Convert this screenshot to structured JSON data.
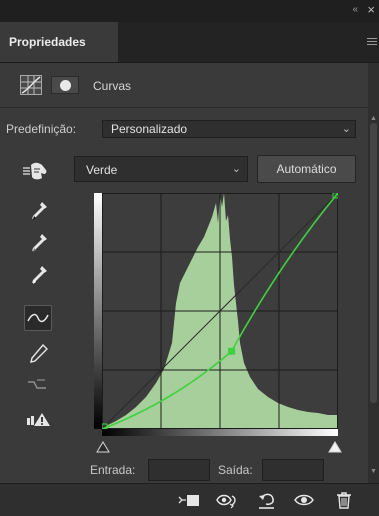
{
  "window": {
    "collapse_glyph": "«",
    "close_glyph": "×"
  },
  "tab": {
    "label": "Propriedades"
  },
  "header": {
    "title": "Curvas",
    "icons": [
      "curves-adjustment-icon",
      "layer-mask-icon"
    ]
  },
  "preset": {
    "label": "Predefinição:",
    "value": "Personalizado"
  },
  "channel": {
    "value": "Verde"
  },
  "auto_button": {
    "label": "Automático"
  },
  "tools": [
    "sample-black-eyedropper-icon",
    "sample-gray-eyedropper-icon",
    "sample-white-eyedropper-icon",
    "edit-points-curve-icon",
    "draw-pencil-icon",
    "smooth-curve-icon",
    "clipping-warning-icon"
  ],
  "active_tool": "edit-points-curve-icon",
  "curve": {
    "channel_color": "#3fd13f",
    "histogram_color": "#a7cf9b",
    "points": [
      [
        0,
        0
      ],
      [
        140,
        84
      ],
      [
        255,
        255
      ]
    ]
  },
  "io": {
    "input_label": "Entrada:",
    "output_label": "Saída:",
    "input_value": "",
    "output_value": ""
  },
  "footer_icons": [
    "clip-to-layer-icon",
    "view-previous-state-icon",
    "reset-defaults-icon",
    "toggle-visibility-icon",
    "delete-adjustment-icon"
  ]
}
